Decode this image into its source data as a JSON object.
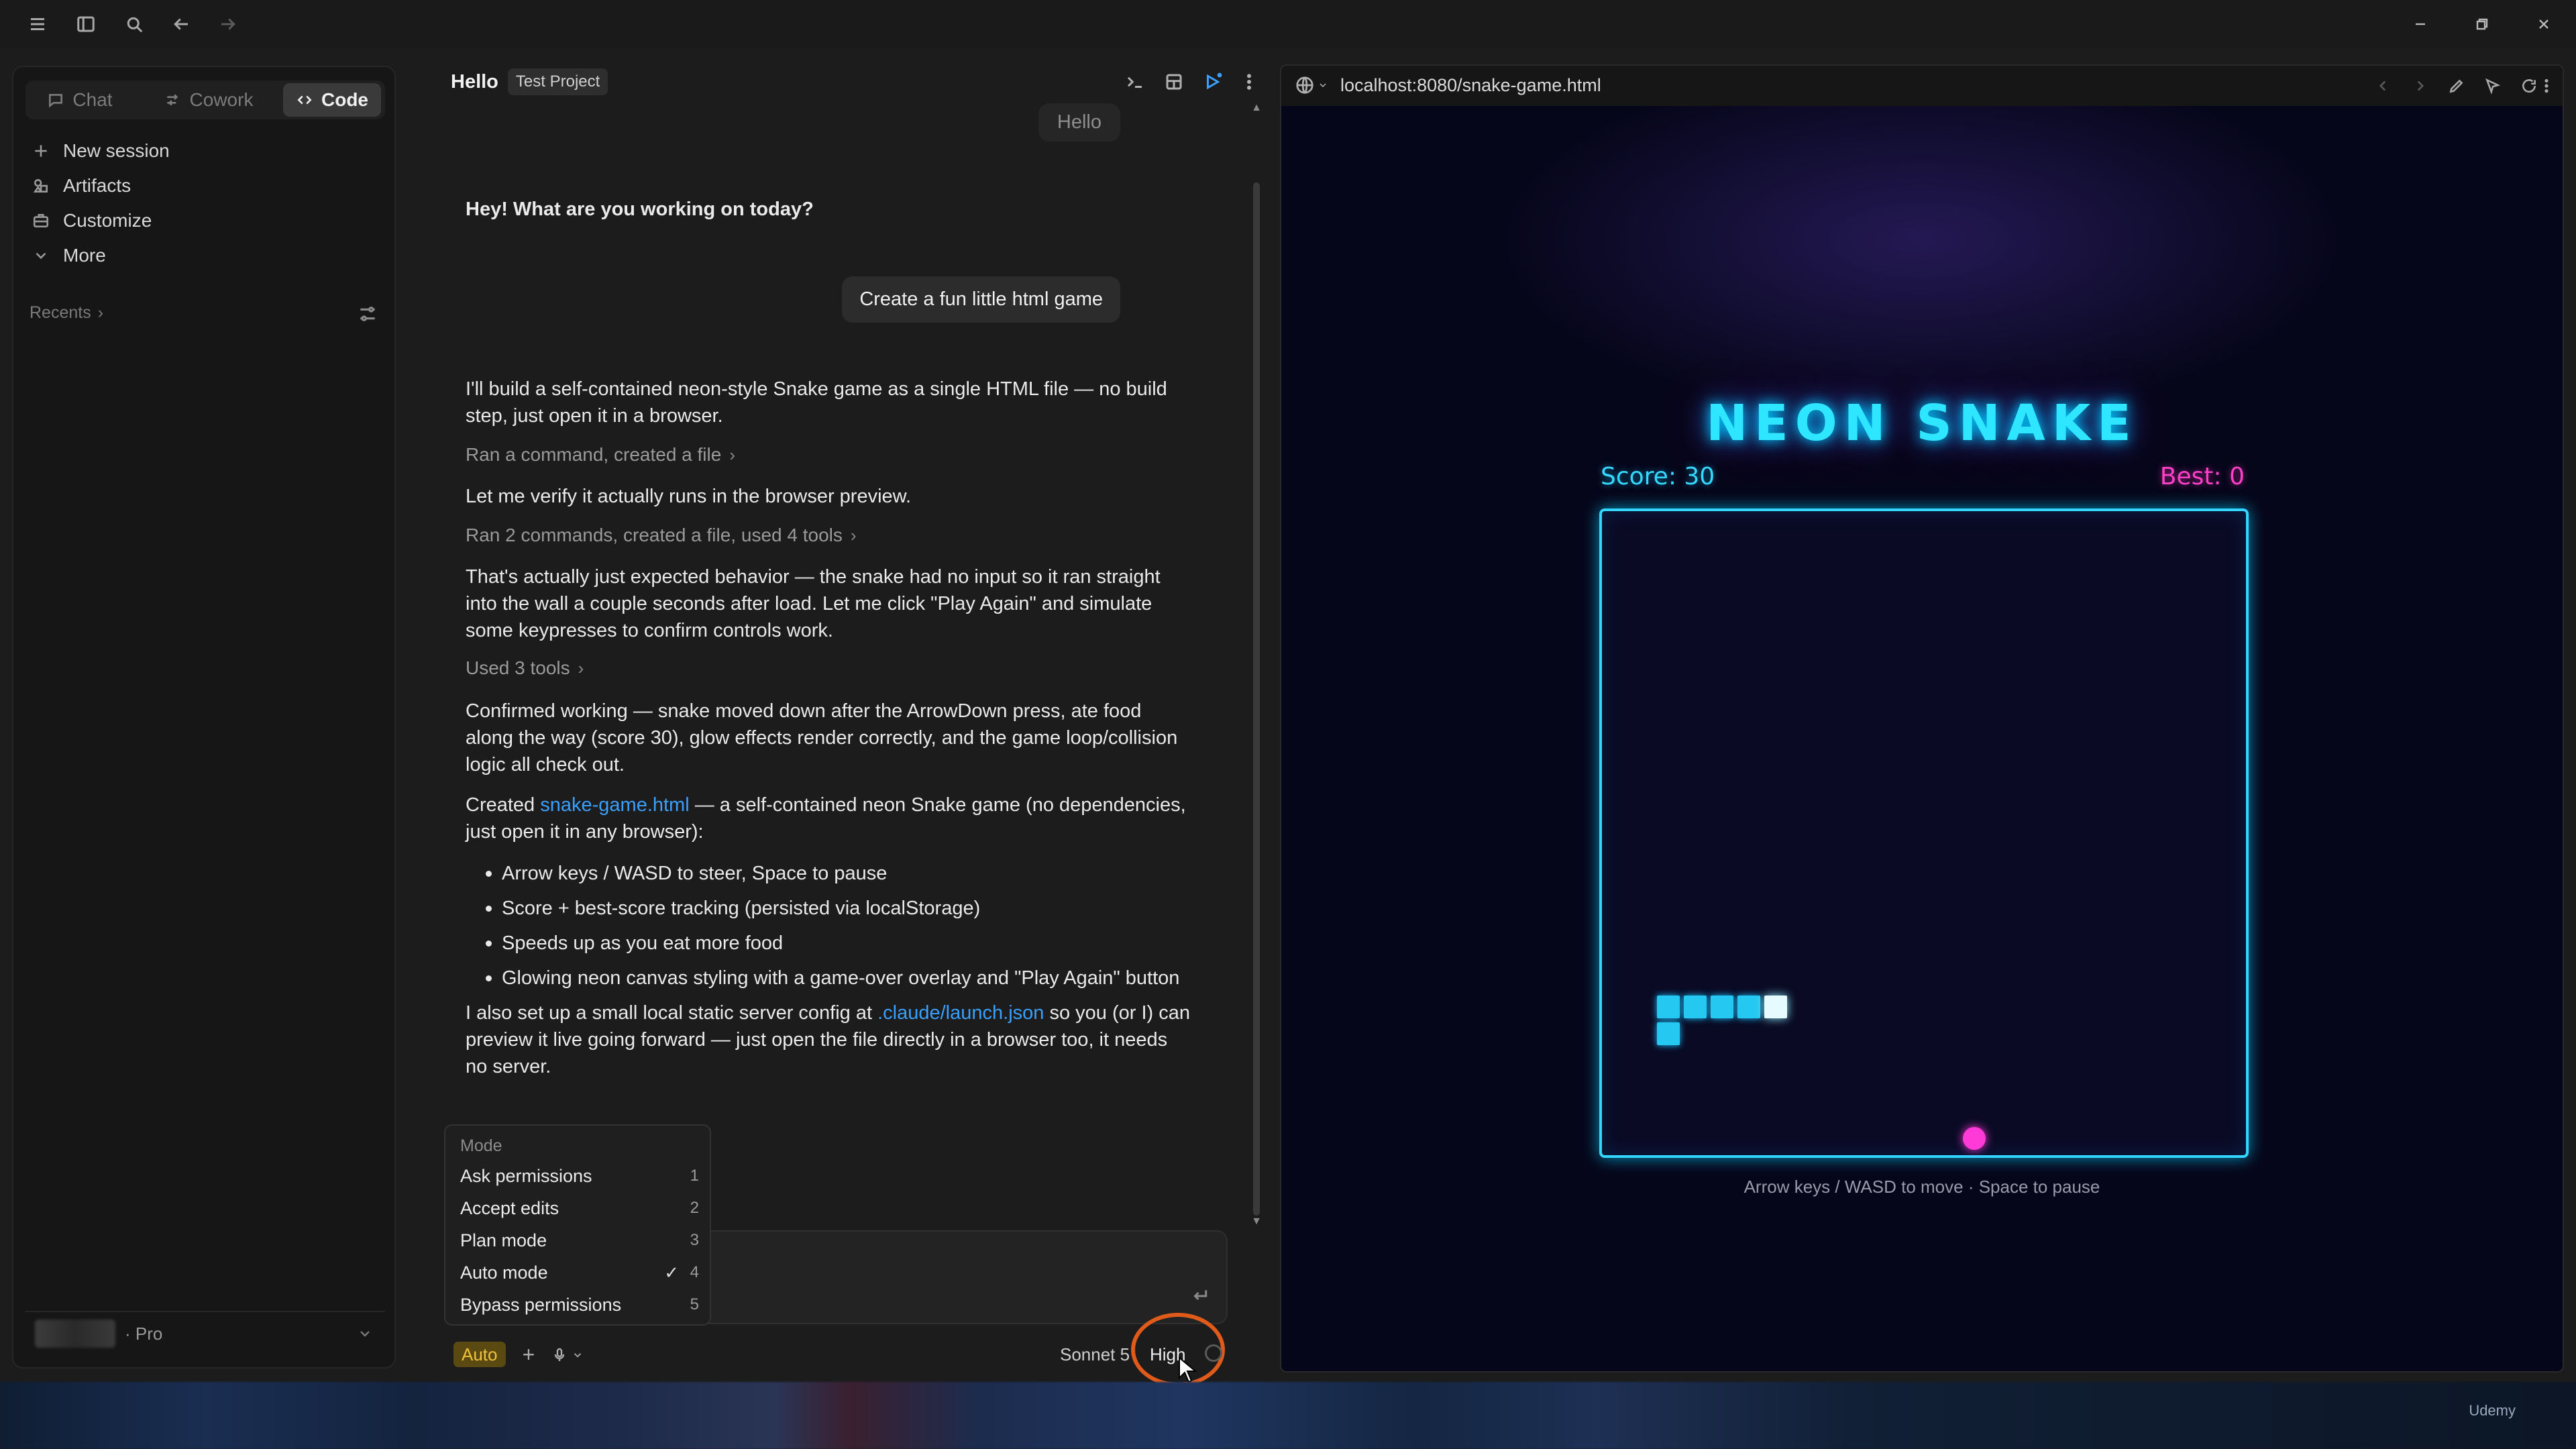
{
  "app": {
    "mode_tabs": [
      {
        "label": "Chat",
        "icon": "chat-bubble-icon",
        "active": false
      },
      {
        "label": "Cowork",
        "icon": "cowork-icon",
        "active": false
      },
      {
        "label": "Code",
        "icon": "code-icon",
        "active": true
      }
    ]
  },
  "sidebar": {
    "items": [
      {
        "label": "New session",
        "icon": "plus-icon"
      },
      {
        "label": "Artifacts",
        "icon": "artifacts-icon"
      },
      {
        "label": "Customize",
        "icon": "briefcase-icon"
      },
      {
        "label": "More",
        "icon": "chevron-down-icon"
      }
    ],
    "recents_label": "Recents",
    "account_plan": "· Pro"
  },
  "chat": {
    "title": "Hello",
    "project": "Test Project",
    "faded_user_bubble": "Hello",
    "assistant_greeting": "Hey! What are you working on today?",
    "user_message": "Create a fun little html game",
    "para1": "I'll build a self-contained neon-style Snake game as a single HTML file — no build step, just open it in a browser.",
    "tool1": "Ran a command, created a file",
    "para2": "Let me verify it actually runs in the browser preview.",
    "tool2": "Ran 2 commands, created a file, used 4 tools",
    "para3": "That's actually just expected behavior — the snake had no input so it ran straight into the wall a couple seconds after load. Let me click \"Play Again\" and simulate some keypresses to confirm controls work.",
    "tool3": "Used 3 tools",
    "para4": "Confirmed working — snake moved down after the ArrowDown press, ate food along the way (score 30), glow effects render correctly, and the game loop/collision logic all check out.",
    "para5_prefix": "Created ",
    "para5_link": "snake-game.html",
    "para5_suffix": " — a self-contained neon Snake game (no dependencies, just open it in any browser):",
    "bullets": [
      "Arrow keys / WASD to steer, Space to pause",
      "Score + best-score tracking (persisted via localStorage)",
      "Speeds up as you eat more food",
      "Glowing neon canvas styling with a game-over overlay and \"Play Again\" button"
    ],
    "para6_prefix": "I also set up a small local static server config at ",
    "para6_link": ".claude/launch.json",
    "para6_suffix": " so you (or I) can preview it live going forward — just open the file directly in a browser too, it needs no server."
  },
  "mode_menu": {
    "title": "Mode",
    "items": [
      {
        "label": "Ask permissions",
        "key": "1",
        "checked": false
      },
      {
        "label": "Accept edits",
        "key": "2",
        "checked": false
      },
      {
        "label": "Plan mode",
        "key": "3",
        "checked": false
      },
      {
        "label": "Auto mode",
        "key": "4",
        "checked": true
      },
      {
        "label": "Bypass permissions",
        "key": "5",
        "checked": false
      }
    ],
    "check_glyph": "✓"
  },
  "composer": {
    "mode_pill": "Auto",
    "plus": "+",
    "model": "Sonnet 5",
    "effort": "High"
  },
  "browser": {
    "url": "localhost:8080/snake-game.html"
  },
  "game": {
    "title": "NEON SNAKE",
    "score_label": "Score: 30",
    "best_label": "Best: 0",
    "hint": "Arrow keys / WASD to move · Space to pause",
    "colors": {
      "snake": "#25c8f0",
      "food": "#ff3ad6",
      "border": "#33d6ff"
    }
  },
  "taskbar": {
    "watermark": "Udemy"
  }
}
